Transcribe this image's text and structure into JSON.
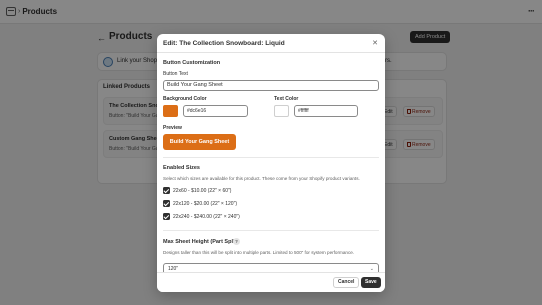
{
  "app": {
    "title": "Products"
  },
  "page": {
    "title": "Products",
    "add_button": "Add Product",
    "banner_text": "Link your Shopify p",
    "banner_tail": "rs.",
    "linked_title": "Linked Products",
    "products": [
      {
        "name": "The Collection Snowb",
        "sub": "Button: \"Build Your Gan"
      },
      {
        "name": "Custom Gang Sheet",
        "sub": "Button: \"Build Your Gan"
      }
    ],
    "edit_label": "Edit",
    "remove_label": "Remove"
  },
  "modal": {
    "title": "Edit: The Collection Snowboard: Liquid",
    "button_customization": {
      "section_title": "Button Customization",
      "text_label": "Button Text",
      "text_value": "Build Your Gang Sheet",
      "bg_label": "Background Color",
      "bg_value": "#dc6e16",
      "text_color_label": "Text Color",
      "text_color_value": "#ffffff"
    },
    "preview": {
      "label": "Preview",
      "button_text": "Build Your Gang Sheet",
      "bg_color": "#dc6e16",
      "text_color": "#ffffff"
    },
    "enabled_sizes": {
      "section_title": "Enabled Sizes",
      "help": "Select which sizes are available for this product. These come from your Shopify product variants.",
      "sizes": [
        {
          "label": "22x60 - $10.00 (22\" × 60\")",
          "checked": true
        },
        {
          "label": "22x120 - $20.00 (22\" × 120\")",
          "checked": true
        },
        {
          "label": "22x240 - $240.00 (22\" × 240\")",
          "checked": true
        }
      ]
    },
    "max_height": {
      "section_title": "Max Sheet Height (Part Split)",
      "help": "Designs taller than this will be split into multiple parts. Limited to 500\" for system performance.",
      "value": "120\""
    },
    "cancel_label": "Cancel",
    "save_label": "Save"
  }
}
